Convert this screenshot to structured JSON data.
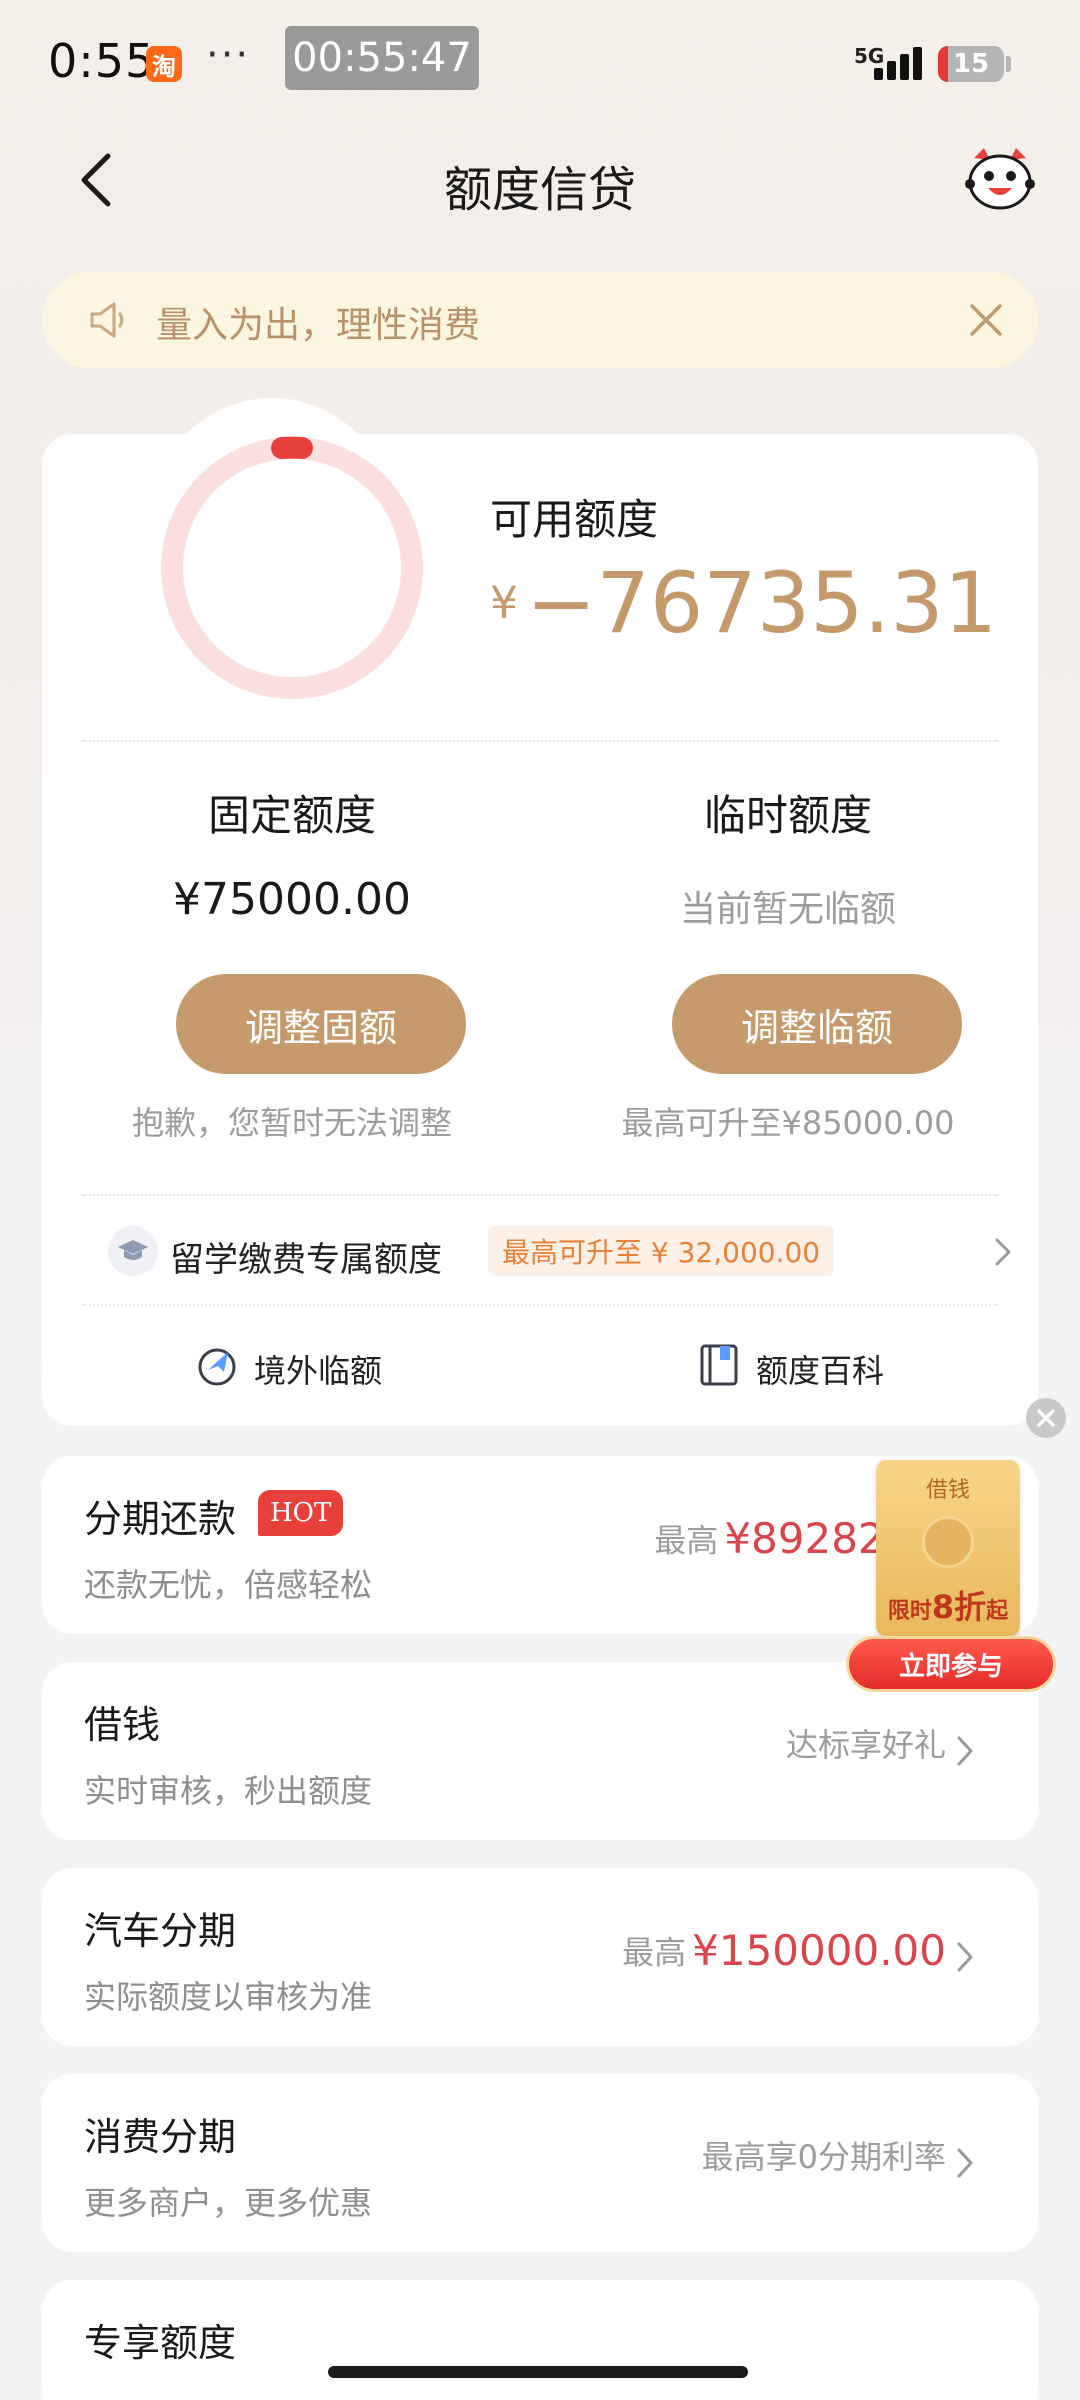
{
  "status_bar": {
    "time": "0:55",
    "app_badge": "淘",
    "dots": "···",
    "timer": "00:55:47",
    "network": "5G",
    "battery": "15"
  },
  "header": {
    "title": "额度信贷"
  },
  "notice": {
    "text": "量入为出，理性消费"
  },
  "credit": {
    "available_label": "可用额度",
    "currency": "¥",
    "available_amount": "−76735.31",
    "ring_accent_color": "#e8413c",
    "ring_track_color": "#fbe0df",
    "fixed": {
      "title": "固定额度",
      "value": "¥75000.00",
      "button": "调整固额",
      "note": "抱歉，您暂时无法调整"
    },
    "temporary": {
      "title": "临时额度",
      "value": "当前暂无临额",
      "button": "调整临额",
      "note": "最高可升至¥85000.00"
    },
    "study_abroad": {
      "label": "留学缴费专属额度",
      "badge": "最高可升至 ¥ 32,000.00"
    },
    "tools": [
      {
        "label": "境外临额"
      },
      {
        "label": "额度百科"
      }
    ]
  },
  "products": [
    {
      "title": "分期还款",
      "badge": "HOT",
      "subtitle": "还款无忧，倍感轻松",
      "prefix": "最高",
      "amount": "¥89282."
    },
    {
      "title": "借钱",
      "subtitle": "实时审核，秒出额度",
      "right_text": "达标享好礼"
    },
    {
      "title": "汽车分期",
      "subtitle": "实际额度以审核为准",
      "prefix": "最高",
      "amount": "¥150000.00"
    },
    {
      "title": "消费分期",
      "subtitle": "更多商户，更多优惠",
      "right_text": "最高享0分期利率"
    },
    {
      "title": "专享额度"
    }
  ],
  "promo": {
    "title": "借钱",
    "discount_prefix": "限时",
    "discount_value": "8折",
    "discount_suffix": "起",
    "button": "立即参与"
  },
  "colors": {
    "accent_gold": "#c49a6c",
    "button_gold": "#c59b6e",
    "amount_red": "#d9454b"
  }
}
